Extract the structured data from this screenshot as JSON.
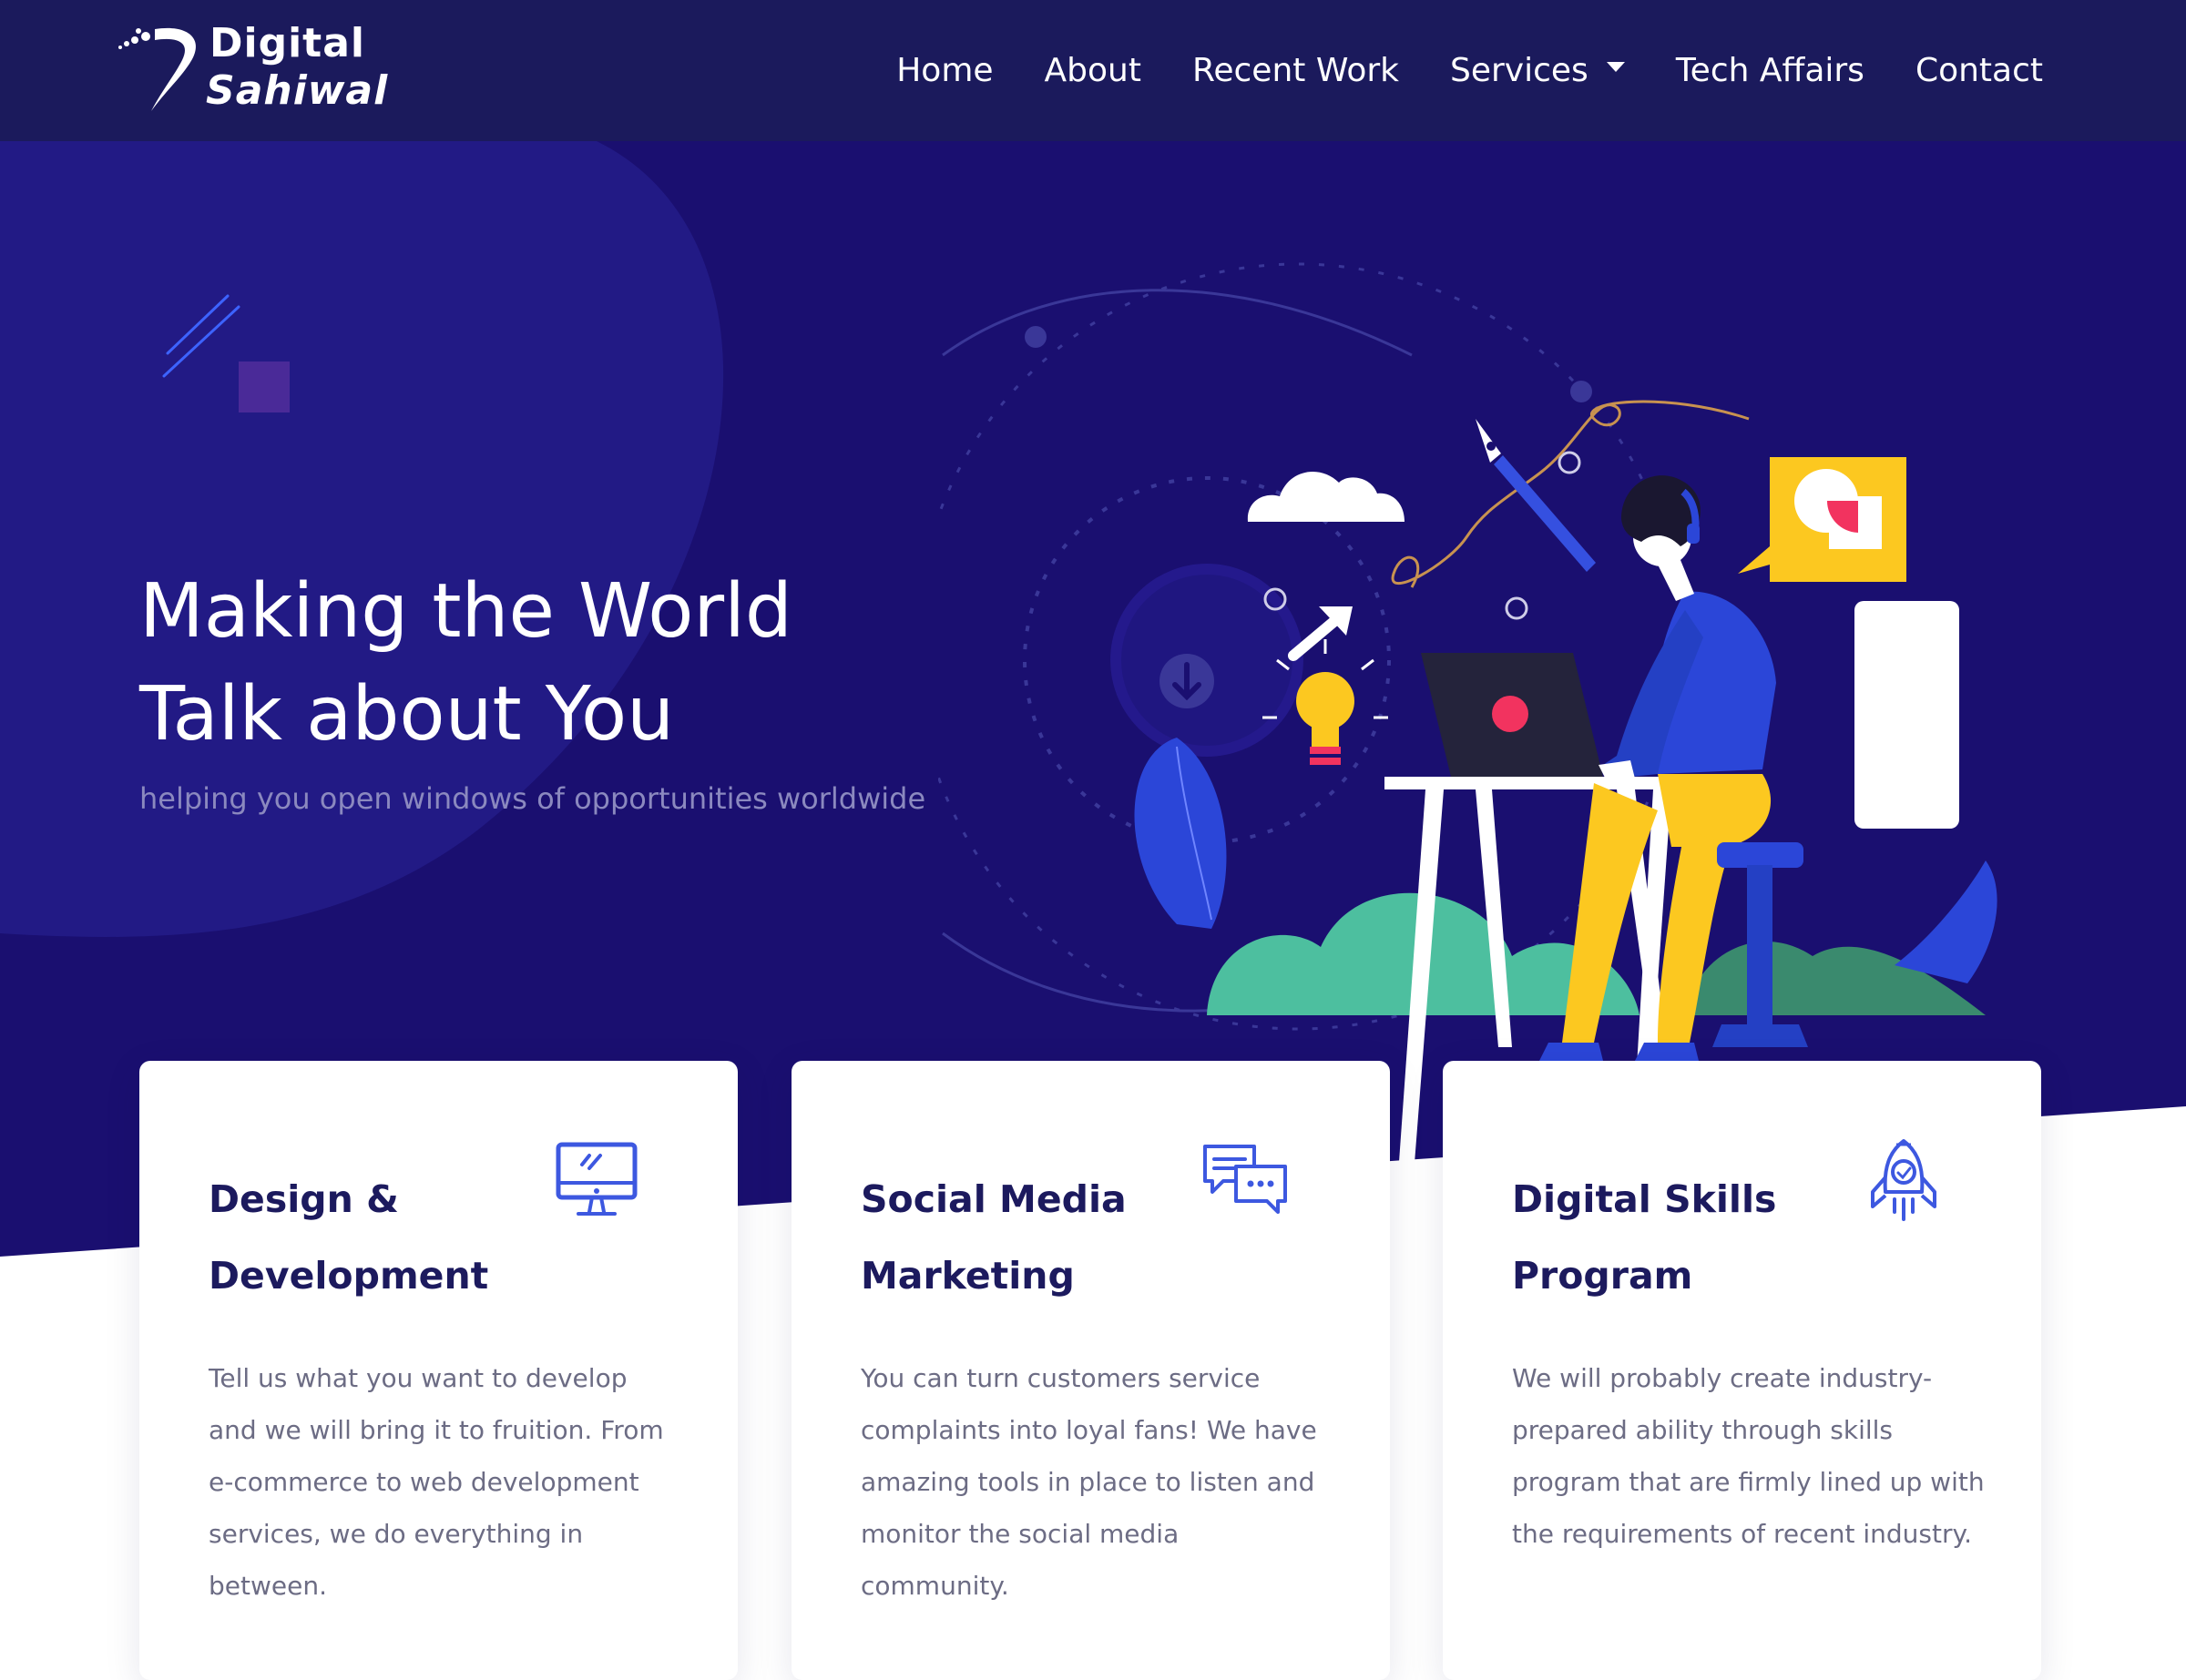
{
  "brand": {
    "logo_line1": "Digital",
    "logo_line2": "Sahiwal"
  },
  "nav": {
    "items": [
      {
        "label": "Home"
      },
      {
        "label": "About"
      },
      {
        "label": "Recent Work"
      },
      {
        "label": "Services",
        "has_dropdown": true
      },
      {
        "label": "Tech Affairs"
      },
      {
        "label": "Contact"
      }
    ]
  },
  "hero": {
    "title_line1": "Making the World",
    "title_line2": "Talk about You",
    "subtitle": "helping you open windows of opportunities worldwide"
  },
  "cards": [
    {
      "title_line1": "Design &",
      "title_line2": "Development",
      "icon": "monitor-icon",
      "text": "Tell us what you want to develop and we will bring it to fruition. From e-commerce to web development services, we do everything in between."
    },
    {
      "title_line1": "Social Media",
      "title_line2": "Marketing",
      "icon": "chat-bubbles-icon",
      "text": "You can turn customers service complaints into loyal fans! We have amazing tools in place to listen and monitor the social media community."
    },
    {
      "title_line1": "Digital Skills",
      "title_line2": "Program",
      "icon": "rocket-icon",
      "text": "We will probably create industry-prepared ability through skills program that are firmly lined up with the requirements of recent industry."
    }
  ],
  "colors": {
    "navbar": "#1b1a5c",
    "hero_bg": "#1a0f70",
    "hero_curve": "#221a85",
    "card_title": "#1c1a5e",
    "accent_blue": "#2b46d8",
    "accent_yellow": "#fcc820",
    "accent_green": "#4dbf9f"
  }
}
